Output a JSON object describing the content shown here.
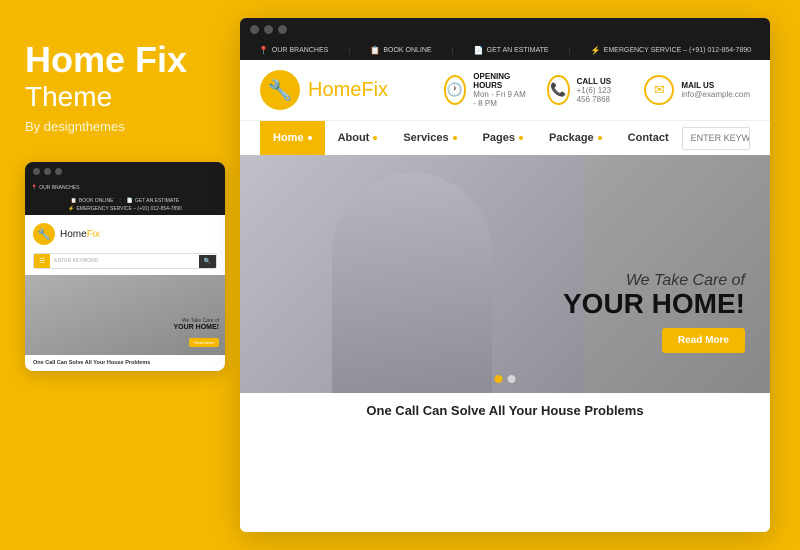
{
  "brand": {
    "title": "Home Fix",
    "subtitle": "Theme",
    "by": "By designthemes"
  },
  "browser": {
    "dots": [
      "dot1",
      "dot2",
      "dot3"
    ]
  },
  "utility_bar": {
    "items": [
      {
        "icon": "📍",
        "label": "OUR BRANCHES"
      },
      {
        "icon": "📋",
        "label": "BOOK ONLINE"
      },
      {
        "icon": "📄",
        "label": "GET AN ESTIMATE"
      },
      {
        "icon": "⚡",
        "label": "EMERGENCY SERVICE – (+91) 012-854-7890"
      }
    ]
  },
  "header": {
    "logo_text_bold": "Home",
    "logo_text_light": "Fix",
    "info_items": [
      {
        "icon": "🕐",
        "label": "OPENING HOURS",
        "value": "Mon - Fri  9 AM - 8 PM"
      },
      {
        "icon": "📞",
        "label": "CALL US",
        "value": "+1(6) 123 456 7868"
      },
      {
        "icon": "✉",
        "label": "MAIL US",
        "value": "info@example.com"
      }
    ]
  },
  "nav": {
    "items": [
      {
        "label": "Home",
        "active": true
      },
      {
        "label": "About",
        "active": false
      },
      {
        "label": "Services",
        "active": false
      },
      {
        "label": "Pages",
        "active": false
      },
      {
        "label": "Package",
        "active": false
      },
      {
        "label": "Contact",
        "active": false
      }
    ],
    "search_placeholder": "ENTER KEYWORD"
  },
  "hero": {
    "tagline1": "We Take Care of",
    "tagline2": "YOUR HOME!",
    "cta": "Read More"
  },
  "bottom_teaser": "One Call Can Solve All Your House Problems",
  "preview": {
    "logo_bold": "Home",
    "logo_light": "Fix",
    "search_placeholder": "ENTER KEYWORD",
    "hero_line1": "We Take Care of",
    "hero_line2": "YOUR HOME!",
    "hero_btn": "Read More",
    "bottom": "One Call Can Solve All Your House Problems"
  }
}
